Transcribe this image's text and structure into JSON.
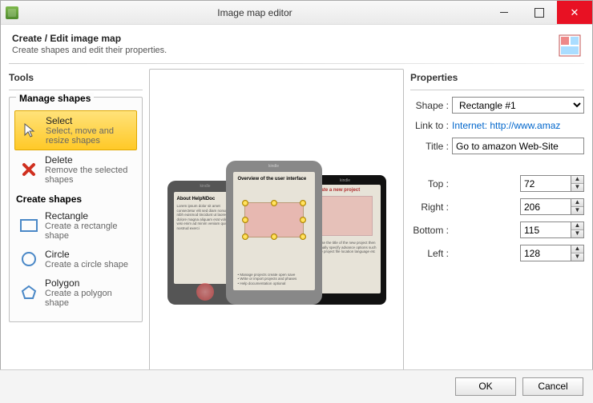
{
  "window": {
    "title": "Image map editor"
  },
  "header": {
    "title": "Create / Edit image map",
    "subtitle": "Create shapes and edit their properties."
  },
  "tools": {
    "panel_title": "Tools",
    "manage_title": "Manage shapes",
    "select": {
      "title": "Select",
      "desc": "Select, move and resize shapes"
    },
    "delete": {
      "title": "Delete",
      "desc": "Remove the selected shapes"
    },
    "create_title": "Create shapes",
    "rectangle": {
      "title": "Rectangle",
      "desc": "Create a rectangle shape"
    },
    "circle": {
      "title": "Circle",
      "desc": "Create a circle shape"
    },
    "polygon": {
      "title": "Polygon",
      "desc": "Create a polygon shape"
    }
  },
  "canvas": {
    "kindle": "kindle",
    "screen1_head": "About HelpNDoc",
    "screen2_head": "Overview of the user interface",
    "screen3_head": "Create a new project"
  },
  "properties": {
    "panel_title": "Properties",
    "shape_label": "Shape :",
    "shape_value": "Rectangle #1",
    "linkto_label": "Link to :",
    "linkto_value": "Internet: http://www.amaz",
    "title_label": "Title :",
    "title_value": "Go to amazon Web-Site",
    "top_label": "Top :",
    "top_value": "72",
    "right_label": "Right :",
    "right_value": "206",
    "bottom_label": "Bottom :",
    "bottom_value": "115",
    "left_label": "Left :",
    "left_value": "128"
  },
  "footer": {
    "ok": "OK",
    "cancel": "Cancel"
  }
}
